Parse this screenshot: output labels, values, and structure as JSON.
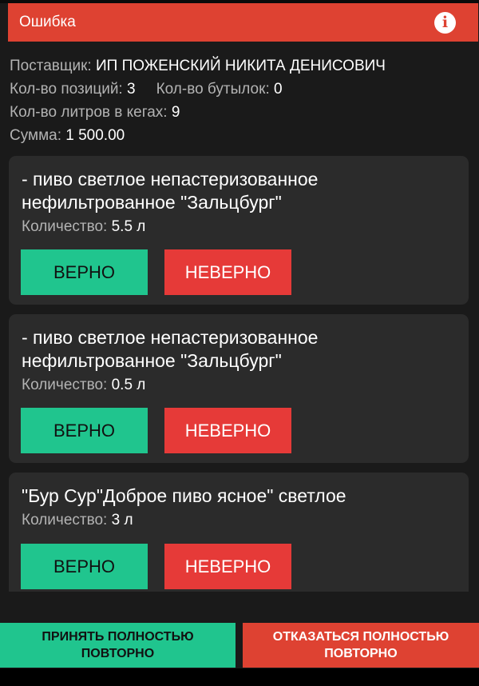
{
  "header": {
    "title": "Ошибка",
    "info_icon": "info-icon"
  },
  "summary": {
    "supplier_label": "Поставщик:",
    "supplier_value": "ИП ПОЖЕНСКИЙ НИКИТА ДЕНИСОВИЧ",
    "positions_label": "Кол-во позиций:",
    "positions_value": "3",
    "bottles_label": "Кол-во бутылок:",
    "bottles_value": "0",
    "liters_label": "Кол-во литров в кегах:",
    "liters_value": "9",
    "sum_label": "Сумма:",
    "sum_value": "1 500.00"
  },
  "items": [
    {
      "name_line1": "- пиво светлое непастеризованное",
      "name_line2": "нефильтрованное \"Зальцбург\"",
      "qty_label": "Количество:",
      "qty_value": "5.5 л",
      "ok_label": "ВЕРНО",
      "bad_label": "НЕВЕРНО"
    },
    {
      "name_line1": "- пиво светлое непастеризованное",
      "name_line2": "нефильтрованное \"Зальцбург\"",
      "qty_label": "Количество:",
      "qty_value": "0.5 л",
      "ok_label": "ВЕРНО",
      "bad_label": "НЕВЕРНО"
    },
    {
      "name_line1": "\"Бур Сур\"Доброе пиво ясное\" светлое",
      "name_line2": "",
      "qty_label": "Количество:",
      "qty_value": "3 л",
      "ok_label": "ВЕРНО",
      "bad_label": "НЕВЕРНО"
    }
  ],
  "footer": {
    "accept_line1": "ПРИНЯТЬ ПОЛНОСТЬЮ",
    "accept_line2": "ПОВТОРНО",
    "reject_line1": "ОТКАЗАТЬСЯ ПОЛНОСТЬЮ",
    "reject_line2": "ПОВТОРНО"
  },
  "colors": {
    "accent_red": "#de4232",
    "accept_green": "#20c58e",
    "reject_red": "#e63a38",
    "card_bg": "#2b2b2b",
    "screen_bg": "#1a1a1a"
  }
}
